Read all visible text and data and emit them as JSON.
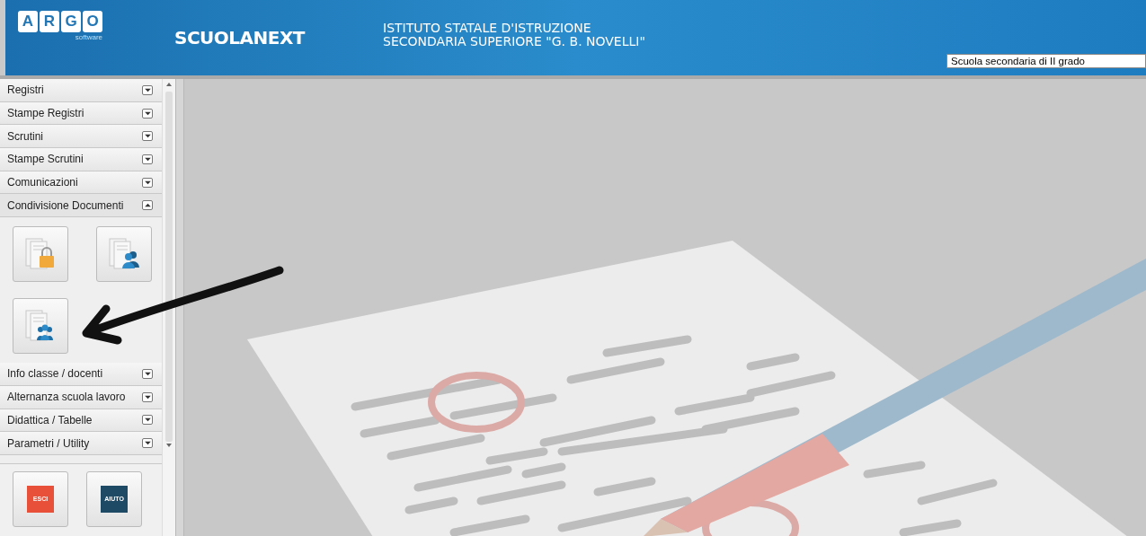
{
  "header": {
    "logo_letters": [
      "A",
      "R",
      "G",
      "O"
    ],
    "logo_sub": "software",
    "product": "SCUOLANEXT",
    "school_lines": [
      "ISTITUTO STATALE D'ISTRUZIONE",
      "SECONDARIA SUPERIORE \"G. B. NOVELLI\""
    ],
    "school_select": {
      "value": "Scuola secondaria di II grado"
    }
  },
  "sidebar": {
    "sections": [
      {
        "label": "Registri",
        "expanded": false
      },
      {
        "label": "Stampe Registri",
        "expanded": false
      },
      {
        "label": "Scrutini",
        "expanded": false
      },
      {
        "label": "Stampe Scrutini",
        "expanded": false
      },
      {
        "label": "Comunicazioni",
        "expanded": false
      },
      {
        "label": "Condivisione Documenti",
        "expanded": true,
        "tools": [
          {
            "kind": "lock"
          },
          {
            "kind": "user"
          },
          {
            "kind": "group"
          }
        ]
      },
      {
        "label": "Info classe / docenti",
        "expanded": false
      },
      {
        "label": "Alternanza scuola lavoro",
        "expanded": false
      },
      {
        "label": "Didattica / Tabelle",
        "expanded": false
      },
      {
        "label": "Parametri / Utility",
        "expanded": false
      }
    ],
    "bottom_buttons": [
      {
        "label": "ESCI",
        "kind": "exit"
      },
      {
        "label": "AIUTO",
        "kind": "help"
      }
    ]
  }
}
